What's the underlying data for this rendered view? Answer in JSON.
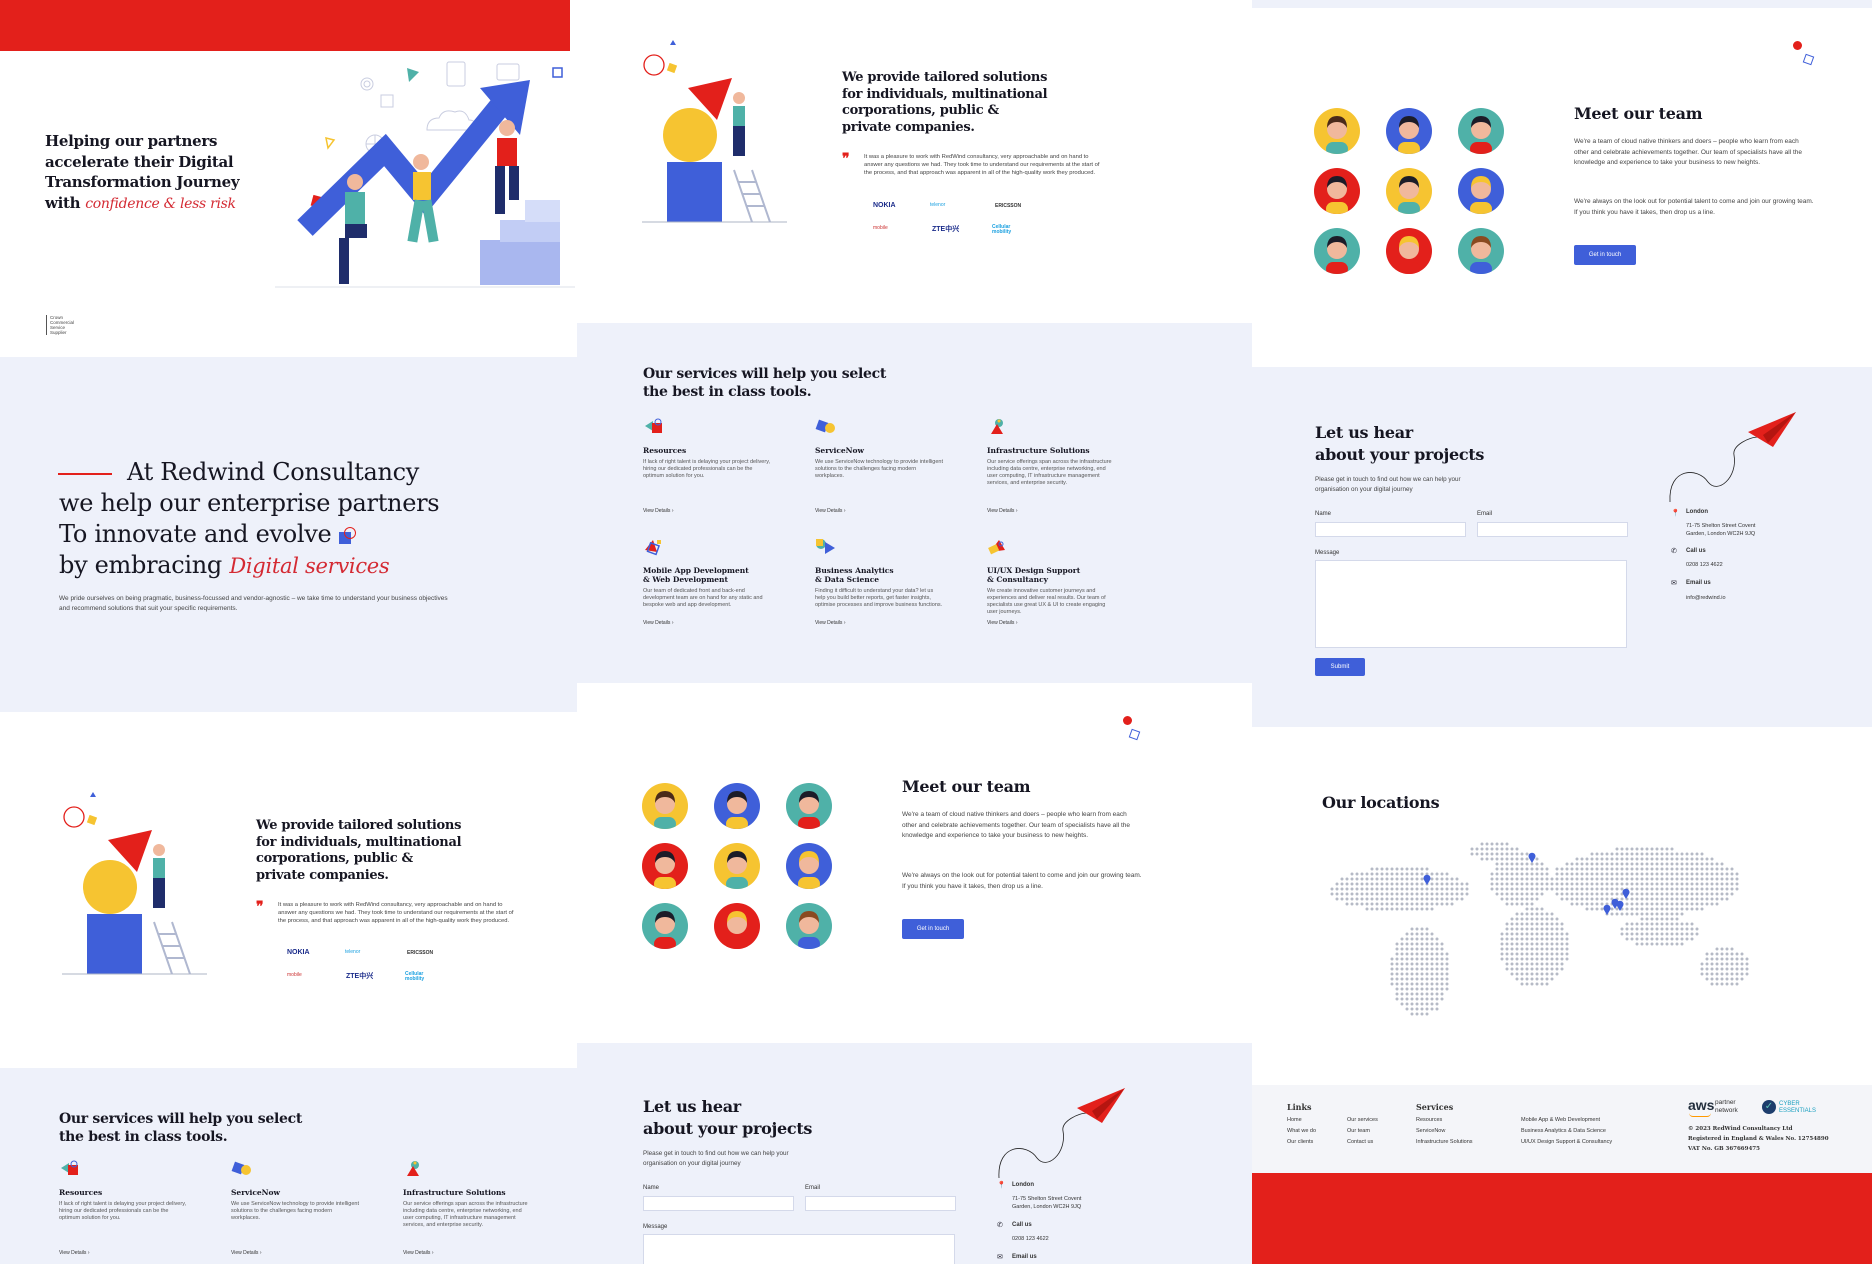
{
  "hero": {
    "title_lines": [
      "Helping our partners",
      "accelerate their Digital",
      "Transformation Journey",
      "with"
    ],
    "title_script": "confidence & less risk",
    "badge": [
      "Crown",
      "Commercial",
      "Service",
      "Supplier"
    ]
  },
  "intro": {
    "line1": "At Redwind Consultancy",
    "line2": "we help our enterprise partners",
    "line3": "To innovate and evolve",
    "line4": "by embracing",
    "line4_script": "Digital services",
    "desc": "We pride ourselves on being pragmatic, business-focussed and vendor-agnostic – we take time to understand your business objectives and recommend solutions that suit your specific requirements."
  },
  "solutions": {
    "title": "We provide tailored solutions for individuals, multinational corporations, public & private companies.",
    "quote": "It was a pleasure to work with RedWind consultancy, very approachable and on hand to answer any questions we had. They took time to understand our requirements at the start of the process, and that approach was apparent in all of the high-quality work they produced.",
    "logos": [
      "NOKIA",
      "telenor",
      "ERICSSON",
      "mobile",
      "ZTE中兴",
      "Cellular mobility"
    ]
  },
  "team": {
    "title": "Meet our team",
    "p1": "We're a team of cloud native thinkers and doers – people who learn from each other and celebrate achievements together. Our team of specialists have all the knowledge and experience to take your business to new heights.",
    "p2": "We're always on the look out for potential talent to come and join our growing team. If you think you have it takes, then drop us a line.",
    "button": "Get in touch"
  },
  "services": {
    "title_line1": "Our services will help you select",
    "title_line2": "the best in class tools.",
    "view_details": "View Details",
    "items": [
      {
        "t1": "Resources",
        "t2": "",
        "desc": "If lack of right talent is delaying your project delivery, hiring our dedicated professionals can be the optimum solution for you."
      },
      {
        "t1": "ServiceNow",
        "t2": "",
        "desc": "We use ServiceNow technology to provide intelligent solutions to the challenges facing modern workplaces."
      },
      {
        "t1": "Infrastructure Solutions",
        "t2": "",
        "desc": "Our service offerings span across the infrastructure including data centre, enterprise networking, end user computing, IT infrastructure management services, and enterprise security."
      },
      {
        "t1": "Mobile App Development",
        "t2": "& Web Development",
        "desc": "Our team of dedicated front and back-end development team are on hand for any static and bespoke web and app development."
      },
      {
        "t1": "Business Analytics",
        "t2": "& Data Science",
        "desc": "Finding it difficult to understand your data? let us help you build better reports, get faster insights, optimise processes and improve business functions."
      },
      {
        "t1": "UI/UX Design Support",
        "t2": "& Consultancy",
        "desc": "We create innovative customer journeys and experiences and deliver real results. Our team of specialists use great UX & UI to create engaging user journeys."
      }
    ]
  },
  "contact": {
    "title_line1": "Let us hear",
    "title_line2": "about your projects",
    "desc": "Please get in touch to find out how we can help your organisation on your digital journey",
    "name_label": "Name",
    "email_label": "Email",
    "message_label": "Message",
    "submit": "Submit",
    "london": "London",
    "addr1": "71-75 Shelton Street Covent",
    "addr2": "Garden, London WC2H 9JQ",
    "call": "Call us",
    "phone": "0208 123 4622",
    "email_us": "Email us",
    "email": "info@redwind.io"
  },
  "locations": {
    "title": "Our locations"
  },
  "footer": {
    "links_title": "Links",
    "links": [
      "Home",
      "Our services",
      "What we do",
      "Our team",
      "Our clients",
      "Contact us"
    ],
    "services_title": "Services",
    "services": [
      "Resources",
      "Mobile App & Web Development",
      "ServiceNow",
      "Business Analytics & Data Science",
      "Infrastructure Solutions",
      "UI/UX Design Support & Consultancy"
    ],
    "aws": "aws",
    "partner": "partner",
    "network": "network",
    "cyber1": "CYBER",
    "cyber2": "ESSENTIALS",
    "copy": "© 2023 RedWind Consultancy Ltd",
    "reg": "Registered in England & Wales No. 12754890",
    "vat": "VAT No. GB 367669475"
  },
  "colors": {
    "red": "#e3201b",
    "blue": "#3f5fd9",
    "bg": "#eef1fa"
  }
}
